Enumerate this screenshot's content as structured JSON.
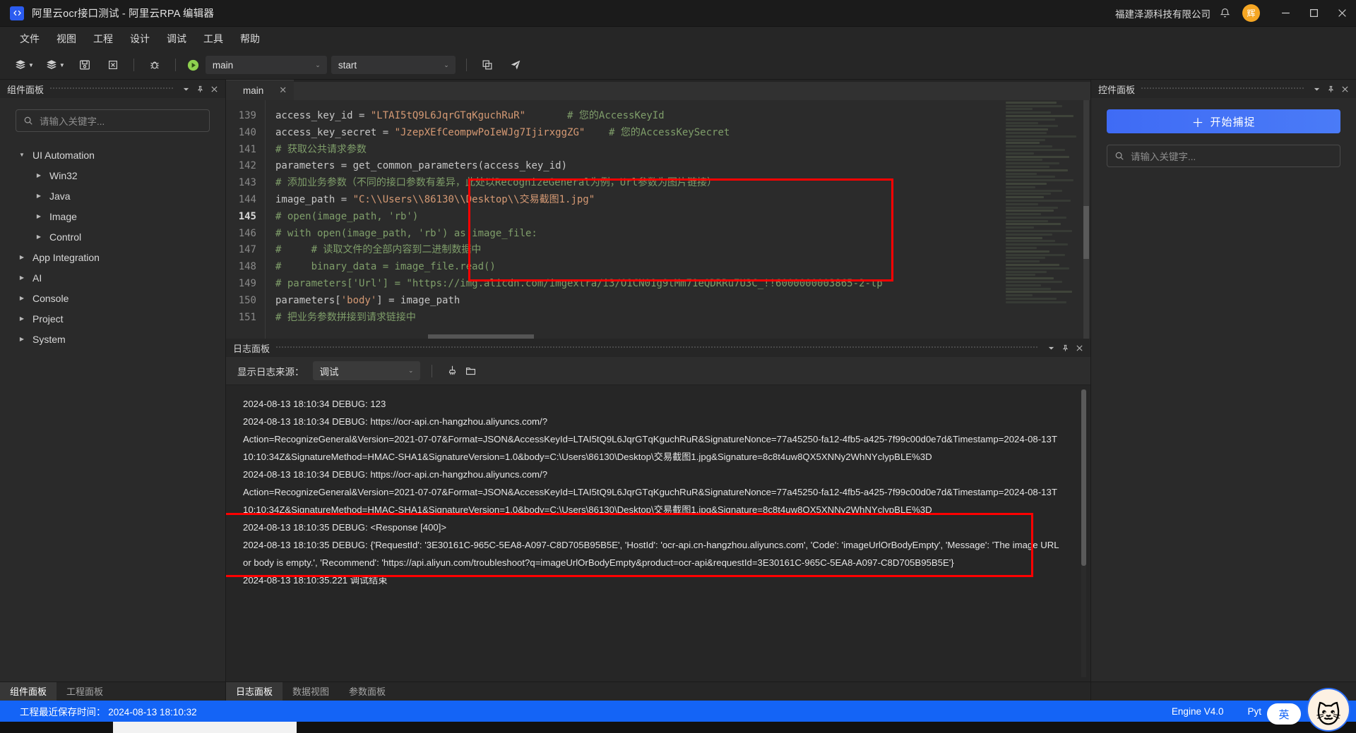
{
  "titlebar": {
    "title": "阿里云ocr接口测试 - 阿里云RPA 编辑器",
    "company": "福建泽源科技有限公司",
    "avatar_text": "辉",
    "logo_icon": "code-brackets-icon",
    "bell_icon": "bell-icon",
    "minimize_icon": "minimize-icon",
    "maximize_icon": "maximize-icon",
    "close_icon": "close-icon"
  },
  "menubar": {
    "items": [
      {
        "label": "文件"
      },
      {
        "label": "视图"
      },
      {
        "label": "工程"
      },
      {
        "label": "设计"
      },
      {
        "label": "调试"
      },
      {
        "label": "工具"
      },
      {
        "label": "帮助"
      }
    ]
  },
  "toolbar": {
    "new_flow_icon": "layers-dropdown-icon",
    "open_flow_icon": "layers-dropdown-icon",
    "save_icon": "save-icon",
    "close_icon": "close-file-icon",
    "debug_icon": "bug-icon",
    "run_icon": "run-play-icon",
    "module_select": "main",
    "function_select": "start",
    "copy_icon": "copy-icon",
    "send_icon": "send-icon"
  },
  "left_panel": {
    "title": "组件面板",
    "collapse_icon": "chevron-down-icon",
    "pin_icon": "pin-icon",
    "close_icon": "close-icon",
    "search_placeholder": "请输入关键字...",
    "search_icon": "search-icon",
    "tree": [
      {
        "label": "UI Automation",
        "level": 0,
        "expanded": true
      },
      {
        "label": "Win32",
        "level": 1,
        "expanded": false
      },
      {
        "label": "Java",
        "level": 1,
        "expanded": false
      },
      {
        "label": "Image",
        "level": 1,
        "expanded": false
      },
      {
        "label": "Control",
        "level": 1,
        "expanded": false
      },
      {
        "label": "App Integration",
        "level": 0,
        "expanded": false
      },
      {
        "label": "AI",
        "level": 0,
        "expanded": false
      },
      {
        "label": "Console",
        "level": 0,
        "expanded": false
      },
      {
        "label": "Project",
        "level": 0,
        "expanded": false
      },
      {
        "label": "System",
        "level": 0,
        "expanded": false
      }
    ],
    "bottom_tabs": [
      {
        "label": "组件面板",
        "active": true
      },
      {
        "label": "工程面板",
        "active": false
      }
    ]
  },
  "editor": {
    "tab_label": "main",
    "tab_close_icon": "close-icon",
    "current_line": 145,
    "lines": [
      {
        "num": 139,
        "segments": [
          {
            "t": "access_key_id ",
            "c": "id"
          },
          {
            "t": "= ",
            "c": "op"
          },
          {
            "t": "\"LTAI5tQ9L6JqrGTqKguchRuR\"",
            "c": "str"
          },
          {
            "t": "       # 您的AccessKeyId",
            "c": "cm"
          }
        ]
      },
      {
        "num": 140,
        "segments": [
          {
            "t": "access_key_secret ",
            "c": "id"
          },
          {
            "t": "= ",
            "c": "op"
          },
          {
            "t": "\"JzepXEfCeompwPoIeWJg7IjirxggZG\"",
            "c": "str"
          },
          {
            "t": "    # 您的AccessKeySecret",
            "c": "cm"
          }
        ]
      },
      {
        "num": 141,
        "segments": [
          {
            "t": "# 获取公共请求参数",
            "c": "cm"
          }
        ]
      },
      {
        "num": 142,
        "segments": [
          {
            "t": "parameters ",
            "c": "id"
          },
          {
            "t": "= ",
            "c": "op"
          },
          {
            "t": "get_common_parameters(access_key_id)",
            "c": "id"
          }
        ]
      },
      {
        "num": 143,
        "segments": [
          {
            "t": "# 添加业务参数（不同的接口参数有差异，此处以RecognizeGeneral为例，Url参数为图片链接）",
            "c": "cm"
          }
        ]
      },
      {
        "num": 144,
        "segments": [
          {
            "t": "image_path ",
            "c": "id"
          },
          {
            "t": "= ",
            "c": "op"
          },
          {
            "t": "\"C:\\\\Users\\\\86130\\\\Desktop\\\\交易截图1.jpg\"",
            "c": "str"
          }
        ]
      },
      {
        "num": 145,
        "segments": [
          {
            "t": "# open(image_path, 'rb')",
            "c": "cm"
          }
        ]
      },
      {
        "num": 146,
        "segments": [
          {
            "t": "# with open(image_path, 'rb') as image_file:",
            "c": "cm"
          }
        ]
      },
      {
        "num": 147,
        "segments": [
          {
            "t": "#     # 读取文件的全部内容到二进制数据中",
            "c": "cm"
          }
        ]
      },
      {
        "num": 148,
        "segments": [
          {
            "t": "#     binary_data = image_file.read()",
            "c": "cm"
          }
        ]
      },
      {
        "num": 149,
        "segments": [
          {
            "t": "# parameters['Url'] = \"https://img.alicdn.com/imgextra/i3/O1CN01g9tMm71eQDRRu7U3C_!!6000000003865-2-tp",
            "c": "cm"
          }
        ]
      },
      {
        "num": 150,
        "segments": [
          {
            "t": "parameters[",
            "c": "id"
          },
          {
            "t": "'body'",
            "c": "str"
          },
          {
            "t": "] = image_path",
            "c": "id"
          }
        ]
      },
      {
        "num": 151,
        "segments": [
          {
            "t": "# 把业务参数拼接到请求链接中",
            "c": "cm"
          }
        ]
      }
    ]
  },
  "log_panel": {
    "title": "日志面板",
    "collapse_icon": "chevron-down-icon",
    "pin_icon": "pin-icon",
    "close_icon": "close-icon",
    "source_label": "显示日志来源：",
    "source_value": "调试",
    "clear_icon": "broom-clear-icon",
    "folder_icon": "open-folder-icon",
    "lines": [
      {
        "text": "2024-08-13 18:10:34 DEBUG: 123",
        "highlight": false
      },
      {
        "text": "2024-08-13 18:10:34 DEBUG: https://ocr-api.cn-hangzhou.aliyuncs.com/?",
        "highlight": false
      },
      {
        "text": "Action=RecognizeGeneral&Version=2021-07-07&Format=JSON&AccessKeyId=LTAI5tQ9L6JqrGTqKguchRuR&SignatureNonce=77a45250-fa12-4fb5-a425-7f99c00d0e7d&Timestamp=2024-08-13T10:10:34Z&SignatureMethod=HMAC-SHA1&SignatureVersion=1.0&body=C:\\Users\\86130\\Desktop\\交易截图1.jpg&Signature=8c8t4uw8QX5XNNy2WhNYclypBLE%3D",
        "highlight": false
      },
      {
        "text": "2024-08-13 18:10:34 DEBUG: https://ocr-api.cn-hangzhou.aliyuncs.com/?",
        "highlight": false
      },
      {
        "text": "Action=RecognizeGeneral&Version=2021-07-07&Format=JSON&AccessKeyId=LTAI5tQ9L6JqrGTqKguchRuR&SignatureNonce=77a45250-fa12-4fb5-a425-7f99c00d0e7d&Timestamp=2024-08-13T10:10:34Z&SignatureMethod=HMAC-SHA1&SignatureVersion=1.0&body=C:\\Users\\86130\\Desktop\\交易截图1.jpg&Signature=8c8t4uw8QX5XNNy2WhNYclypBLE%3D",
        "highlight": false
      },
      {
        "text": "2024-08-13 18:10:35 DEBUG: <Response [400]>",
        "highlight": true
      },
      {
        "text": "2024-08-13 18:10:35 DEBUG: {'RequestId': '3E30161C-965C-5EA8-A097-C8D705B95B5E', 'HostId': 'ocr-api.cn-hangzhou.aliyuncs.com', 'Code': 'imageUrlOrBodyEmpty', 'Message': 'The image URL or body is empty.', 'Recommend': 'https://api.aliyun.com/troubleshoot?q=imageUrlOrBodyEmpty&product=ocr-api&requestId=3E30161C-965C-5EA8-A097-C8D705B95B5E'}",
        "highlight": true
      },
      {
        "text": "2024-08-13 18:10:35.221 调试结束",
        "highlight": false
      }
    ],
    "bottom_tabs": [
      {
        "label": "日志面板",
        "active": true
      },
      {
        "label": "数据视图",
        "active": false
      },
      {
        "label": "参数面板",
        "active": false
      }
    ]
  },
  "right_panel": {
    "title": "控件面板",
    "collapse_icon": "chevron-down-icon",
    "pin_icon": "pin-icon",
    "close_icon": "close-icon",
    "capture_button": "开始捕捉",
    "capture_plus": "＋",
    "search_placeholder": "请输入关键字...",
    "search_icon": "search-icon"
  },
  "statusbar": {
    "save_time": "工程最近保存时间： 2024-08-13 18:10:32",
    "engine": "Engine V4.0",
    "language": "Pyt",
    "accent_color": "#1464f6"
  },
  "ime": {
    "mode": "英"
  },
  "colors": {
    "highlight_box": "#ff0000",
    "accent_blue": "#1464f6",
    "capture_blue": "#3f6bf5",
    "avatar_orange": "#f5a623",
    "run_green": "#8fd14f"
  }
}
